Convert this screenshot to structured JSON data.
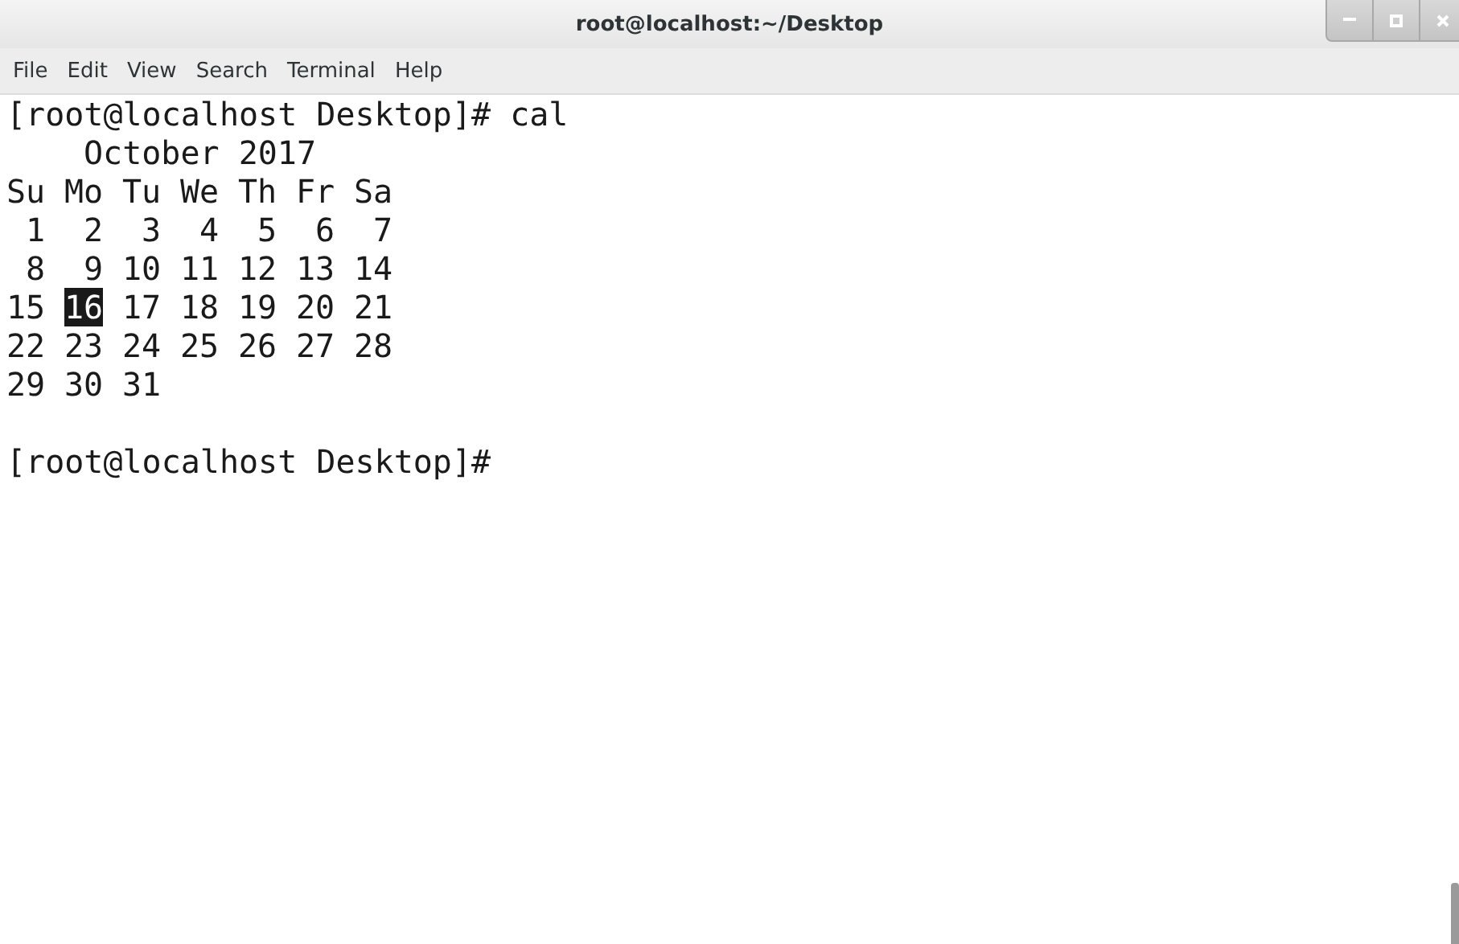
{
  "window": {
    "title": "root@localhost:~/Desktop"
  },
  "menu": [
    "File",
    "Edit",
    "View",
    "Search",
    "Terminal",
    "Help"
  ],
  "terminal": {
    "command_line": "[root@localhost Desktop]# cal",
    "calendar": {
      "month": "October 2017",
      "weekdays": [
        "Su",
        "Mo",
        "Tu",
        "We",
        "Th",
        "Fr",
        "Sa"
      ],
      "weeks": [
        [
          {
            "text": "1",
            "selected": false
          },
          {
            "text": "2",
            "selected": false
          },
          {
            "text": "3",
            "selected": false
          },
          {
            "text": "4",
            "selected": false
          },
          {
            "text": "5",
            "selected": false
          },
          {
            "text": "6",
            "selected": false
          },
          {
            "text": "7",
            "selected": false
          }
        ],
        [
          {
            "text": "8",
            "selected": false
          },
          {
            "text": "9",
            "selected": false
          },
          {
            "text": "10",
            "selected": false
          },
          {
            "text": "11",
            "selected": false
          },
          {
            "text": "12",
            "selected": false
          },
          {
            "text": "13",
            "selected": false
          },
          {
            "text": "14",
            "selected": false
          }
        ],
        [
          {
            "text": "15",
            "selected": false
          },
          {
            "text": "16",
            "selected": true
          },
          {
            "text": "17",
            "selected": false
          },
          {
            "text": "18",
            "selected": false
          },
          {
            "text": "19",
            "selected": false
          },
          {
            "text": "20",
            "selected": false
          },
          {
            "text": "21",
            "selected": false
          }
        ],
        [
          {
            "text": "22",
            "selected": false
          },
          {
            "text": "23",
            "selected": false
          },
          {
            "text": "24",
            "selected": false
          },
          {
            "text": "25",
            "selected": false
          },
          {
            "text": "26",
            "selected": false
          },
          {
            "text": "27",
            "selected": false
          },
          {
            "text": "28",
            "selected": false
          }
        ],
        [
          {
            "text": "29",
            "selected": false
          },
          {
            "text": "30",
            "selected": false
          },
          {
            "text": "31",
            "selected": false
          }
        ]
      ]
    },
    "prompt": "[root@localhost Desktop]#"
  }
}
